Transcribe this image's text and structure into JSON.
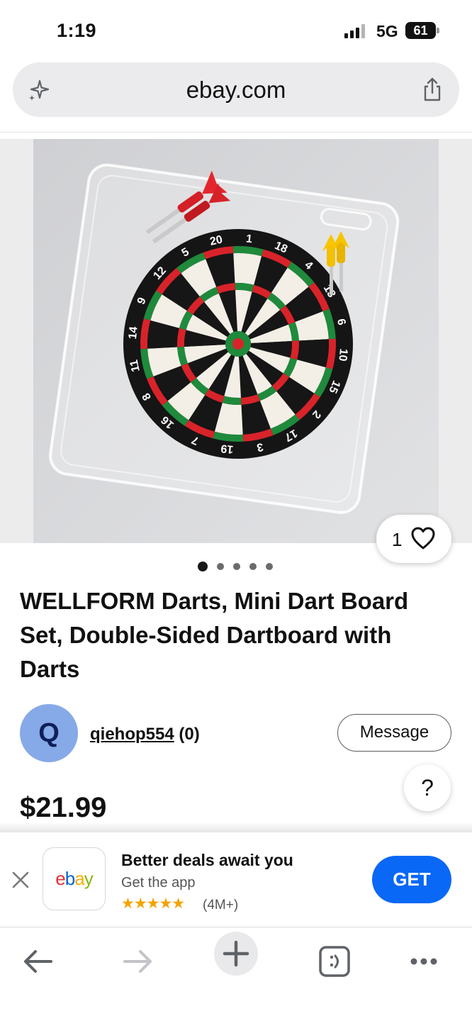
{
  "status_bar": {
    "time": "1:19",
    "network": "5G",
    "battery": "61"
  },
  "browser": {
    "url": "ebay.com"
  },
  "gallery": {
    "watch_count": "1",
    "image_count": 5,
    "active_index": 0,
    "dartboard_numbers": [
      "20",
      "1",
      "18",
      "4",
      "13",
      "6",
      "10",
      "15",
      "2",
      "17",
      "3",
      "19",
      "7",
      "16",
      "8",
      "11",
      "14",
      "9",
      "12",
      "5"
    ]
  },
  "listing": {
    "title": "WELLFORM Darts, Mini Dart Board Set, Double-Sided Dartboard with Darts",
    "price": "$21.99"
  },
  "seller": {
    "initial": "Q",
    "name": "qiehop554",
    "feedback": "(0)",
    "message_label": "Message"
  },
  "help": {
    "label": "?"
  },
  "app_banner": {
    "logo_letters": [
      "e",
      "b",
      "a",
      "y"
    ],
    "logo_colors": [
      "#e53238",
      "#0064d2",
      "#f5af02",
      "#86b817"
    ],
    "title": "Better deals await you",
    "subtitle": "Get the app",
    "stars": "★★★★★",
    "rating_count": "(4M+)",
    "get_label": "GET"
  },
  "colors": {
    "accent": "#0968f6",
    "avatar": "#86a9e8",
    "star": "#f5a300"
  },
  "toolbar": {
    "icons": [
      "back-arrow-icon",
      "forward-arrow-icon",
      "new-tab-plus-icon",
      "tabs-icon",
      "more-icon"
    ]
  }
}
